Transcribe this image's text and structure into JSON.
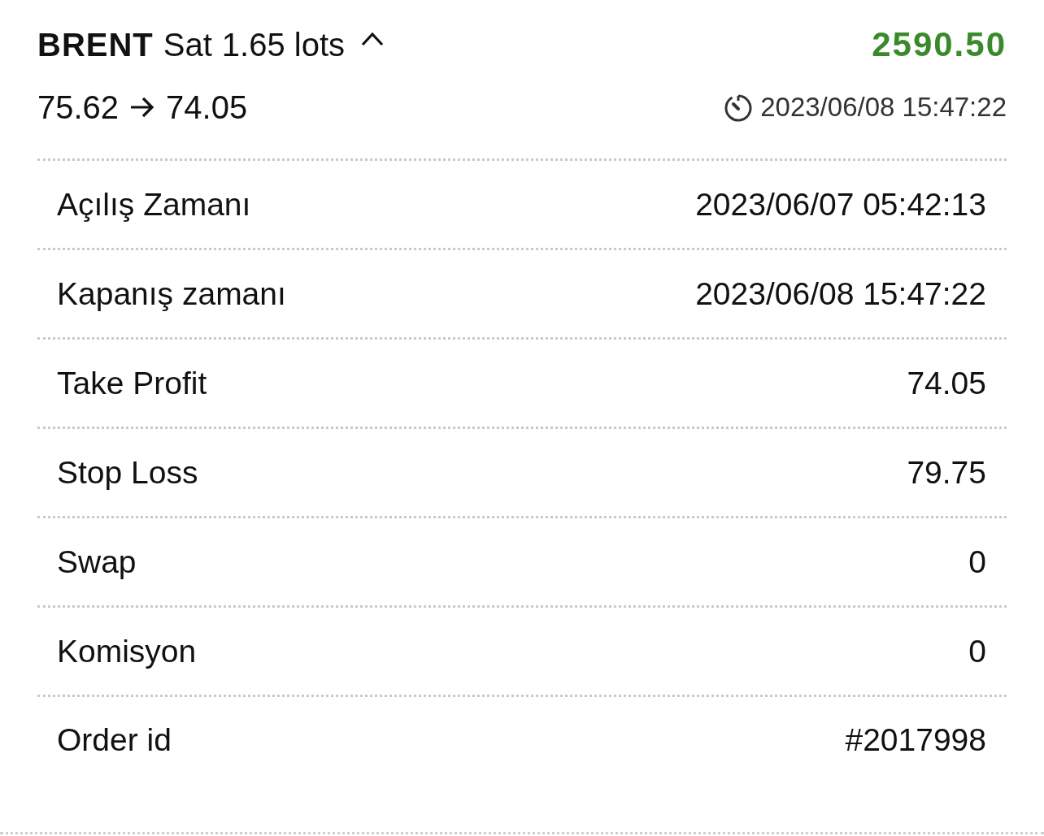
{
  "trade": {
    "symbol": "BRENT",
    "side": "Sat",
    "volume": "1.65 lots",
    "expanded": true,
    "profit": "2590.50",
    "open_price": "75.62",
    "close_price": "74.05",
    "close_time": "2023/06/08 15:47:22"
  },
  "details": [
    {
      "label": "Açılış Zamanı",
      "value": "2023/06/07 05:42:13"
    },
    {
      "label": "Kapanış zamanı",
      "value": "2023/06/08 15:47:22"
    },
    {
      "label": "Take Profit",
      "value": "74.05"
    },
    {
      "label": "Stop Loss",
      "value": "79.75"
    },
    {
      "label": "Swap",
      "value": "0"
    },
    {
      "label": "Komisyon",
      "value": "0"
    },
    {
      "label": "Order id",
      "value": "#2017998"
    }
  ]
}
